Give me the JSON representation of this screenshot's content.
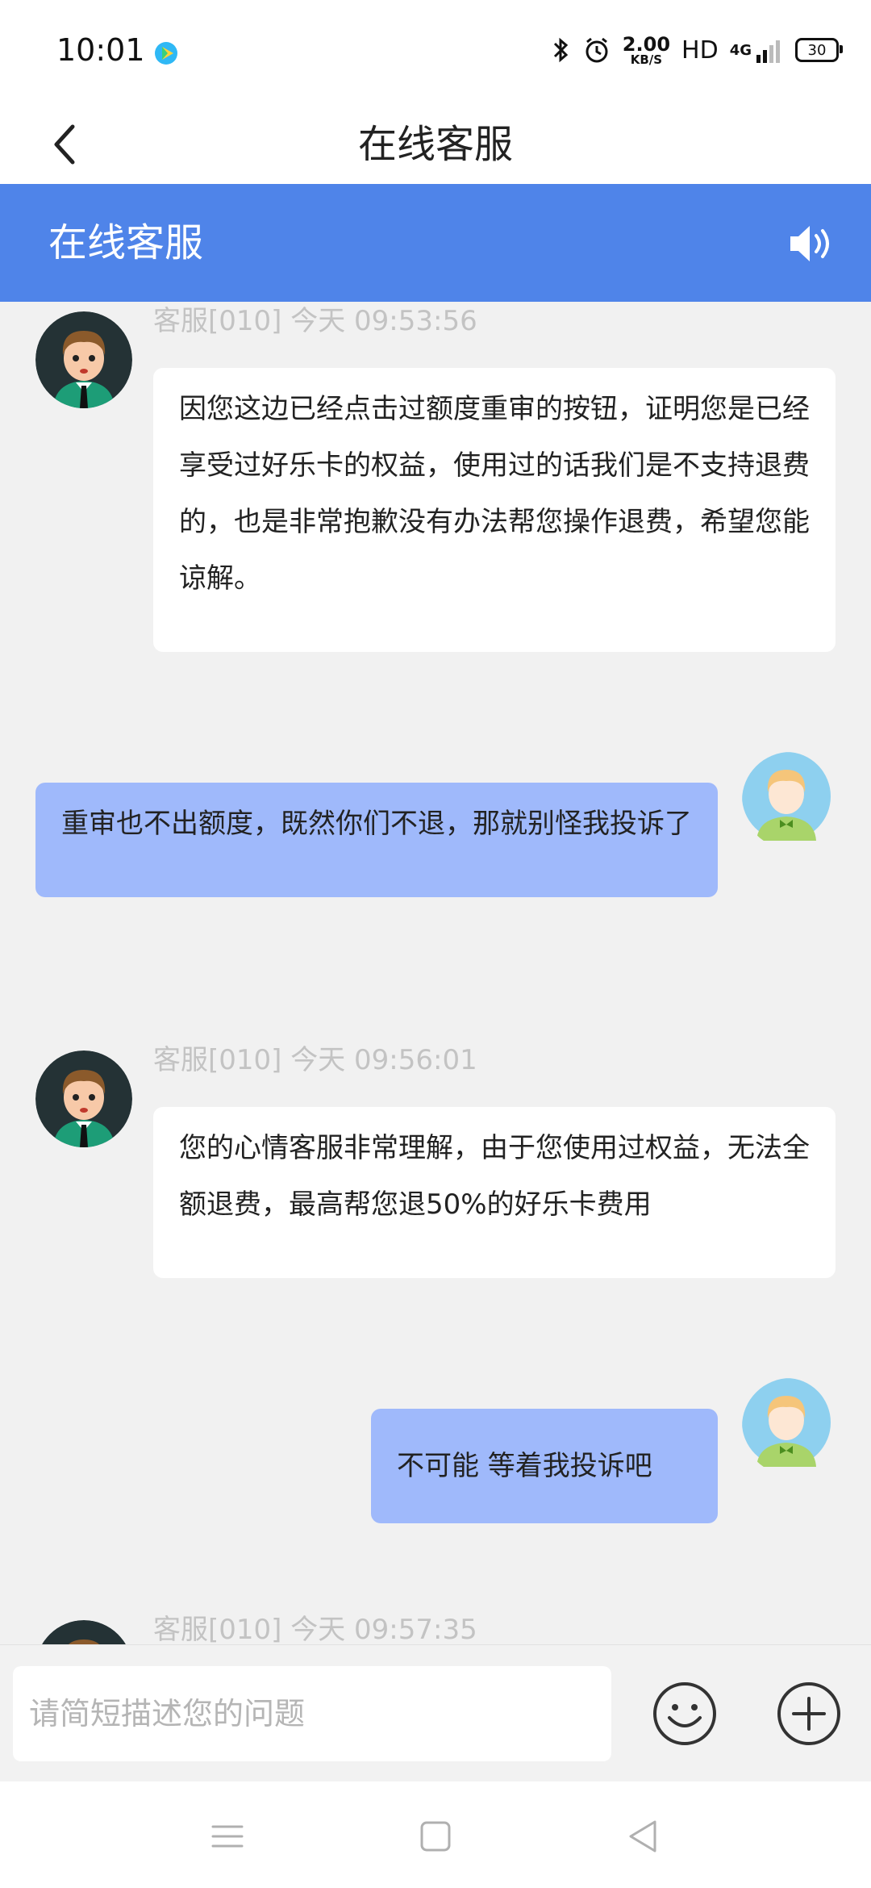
{
  "status_bar": {
    "time": "10:01",
    "net_speed_value": "2.00",
    "net_speed_unit": "KB/S",
    "hd": "HD",
    "network": "4G",
    "battery": "30"
  },
  "nav": {
    "title": "在线客服"
  },
  "chat_header": {
    "title": "在线客服"
  },
  "messages": [
    {
      "sender": "agent",
      "meta": "客服[010]  今天 09:53:56",
      "text": "因您这边已经点击过额度重审的按钮，证明您是已经享受过好乐卡的权益，使用过的话我们是不支持退费的，也是非常抱歉没有办法帮您操作退费，希望您能谅解。"
    },
    {
      "sender": "user",
      "text": "重审也不出额度，既然你们不退，那就别怪我投诉了"
    },
    {
      "sender": "agent",
      "meta": "客服[010]  今天 09:56:01",
      "text": "您的心情客服非常理解，由于您使用过权益，无法全额退费，最高帮您退50%的好乐卡费用"
    },
    {
      "sender": "user",
      "text": "不可能  等着我投诉吧"
    },
    {
      "sender": "agent",
      "meta": "客服[010]  今天 09:57:35"
    }
  ],
  "input": {
    "placeholder": "请简短描述您的问题"
  },
  "colors": {
    "header_blue": "#4f84e9",
    "user_bubble": "#9fb9fb",
    "agent_bubble": "#ffffff",
    "background": "#f1f1f1"
  },
  "icons": [
    "back-arrow-icon",
    "speaker-icon",
    "emoji-icon",
    "plus-icon",
    "menu-icon",
    "home-icon",
    "back-triangle-icon"
  ]
}
